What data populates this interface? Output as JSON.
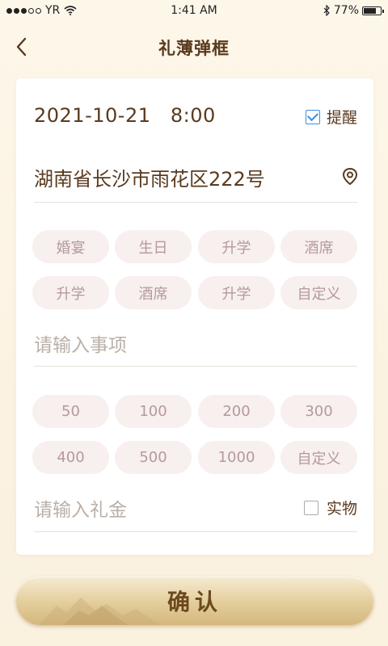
{
  "status": {
    "carrier": "YR",
    "time": "1:41 AM",
    "battery": "77%",
    "signal_bars": 3,
    "signal_total": 5,
    "battery_level": 0.77
  },
  "nav": {
    "title": "礼薄弹框",
    "back_icon": "chevron-left-icon"
  },
  "form": {
    "date": "2021-10-21",
    "time": "8:00",
    "remind_label": "提醒",
    "remind_checked": true,
    "address": "湖南省长沙市雨花区222号",
    "location_icon": "location-pin-icon",
    "event_tags": [
      "婚宴",
      "生日",
      "升学",
      "酒席",
      "升学",
      "酒席",
      "升学",
      "自定义"
    ],
    "event_placeholder": "请输入事项",
    "amount_tags": [
      "50",
      "100",
      "200",
      "300",
      "400",
      "500",
      "1000",
      "自定义"
    ],
    "amount_placeholder": "请输入礼金",
    "physical_label": "实物",
    "physical_checked": false
  },
  "confirm_label": "确认",
  "colors": {
    "text_brown": "#5a3a1e",
    "chip_bg": "#f8efef",
    "chip_text": "#b59a9a",
    "checkbox_blue": "#3d8fe0",
    "gold": "#d4b77c"
  }
}
